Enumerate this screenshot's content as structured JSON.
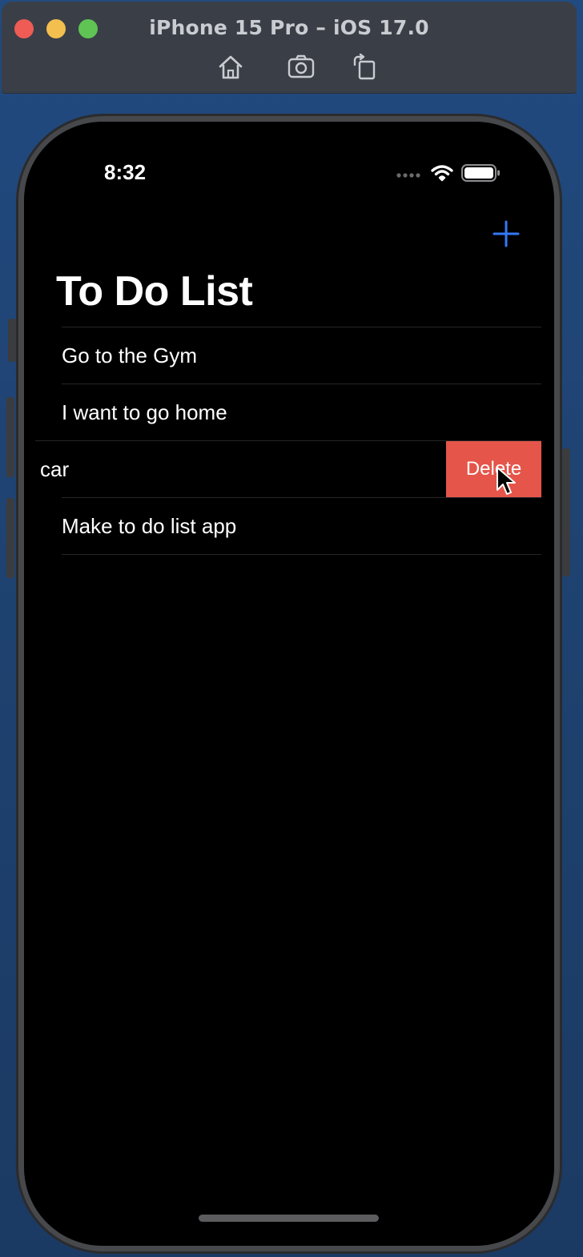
{
  "window": {
    "title": "iPhone 15 Pro – iOS 17.0",
    "toolbar": {
      "home_icon": "home-icon",
      "screenshot_icon": "camera-icon",
      "rotate_icon": "rotate-icon"
    }
  },
  "status_bar": {
    "time": "8:32"
  },
  "nav": {
    "title": "To Do List",
    "add_icon": "plus-icon"
  },
  "todos": [
    {
      "text": "Go to the Gym"
    },
    {
      "text": "I want to go home"
    },
    {
      "text": "car",
      "swiped": true,
      "action": "Delete"
    },
    {
      "text": "Make to do list app"
    }
  ],
  "colors": {
    "accent": "#3478f6",
    "delete": "#e5554a",
    "background": "#000000",
    "text": "#ffffff"
  }
}
